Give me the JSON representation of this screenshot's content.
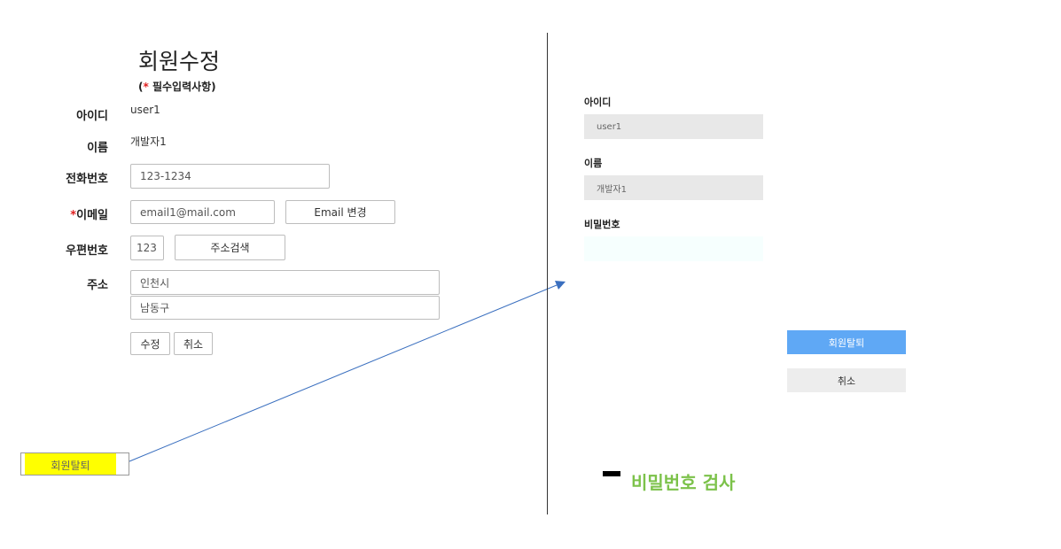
{
  "left_form": {
    "title": "회원수정",
    "subtitle_open": "(",
    "subtitle_star": "*",
    "subtitle_text": " 필수입력사항)",
    "fields": {
      "id": {
        "label": "아이디",
        "value": "user1"
      },
      "name": {
        "label": "이름",
        "value": "개발자1"
      },
      "phone": {
        "label": "전화번호",
        "value": "123-1234"
      },
      "email": {
        "star": "*",
        "label": "이메일",
        "value": "email1@mail.com",
        "button": "Email 변경"
      },
      "zip": {
        "label": "우편번호",
        "value": "123",
        "button": "주소검색"
      },
      "address": {
        "label": "주소",
        "line1": "인천시",
        "line2": "남동구"
      }
    },
    "buttons": {
      "submit": "수정",
      "cancel": "취소"
    },
    "withdraw_button": "회원탈퇴"
  },
  "right_panel": {
    "id_label": "아이디",
    "id_value": "user1",
    "name_label": "이름",
    "name_value": "개발자1",
    "password_label": "비밀번호",
    "password_value": "",
    "withdraw_button": "회원탈퇴",
    "cancel_button": "취소"
  },
  "annotation": {
    "note": "비밀번호 검사",
    "highlight_color": "#ffff00",
    "note_color": "#7cc24a",
    "arrow_color": "#3a6fbf"
  }
}
